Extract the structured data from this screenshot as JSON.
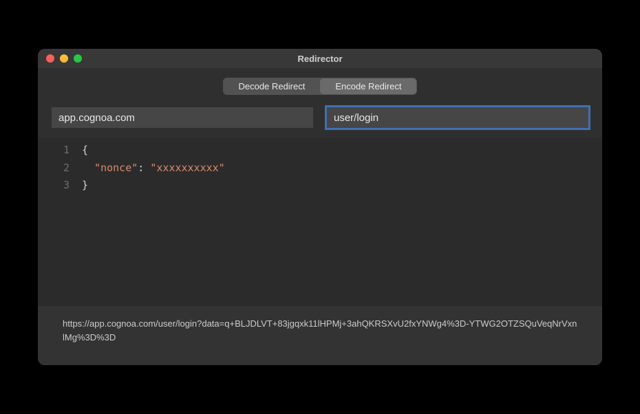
{
  "window": {
    "title": "Redirector"
  },
  "tabs": {
    "decode": "Decode Redirect",
    "encode": "Encode Redirect",
    "active": "encode"
  },
  "inputs": {
    "domain": "app.cognoa.com",
    "path": "user/login"
  },
  "code": {
    "lines": [
      {
        "num": "1",
        "type": "open"
      },
      {
        "num": "2",
        "type": "kv",
        "key": "\"nonce\"",
        "val": "\"xxxxxxxxxx\""
      },
      {
        "num": "3",
        "type": "close"
      }
    ]
  },
  "output": {
    "url": "https://app.cognoa.com/user/login?data=q+BLJDLVT+83jgqxk11lHPMj+3ahQKRSXvU2fxYNWg4%3D-YTWG2OTZSQuVeqNrVxnlMg%3D%3D"
  }
}
